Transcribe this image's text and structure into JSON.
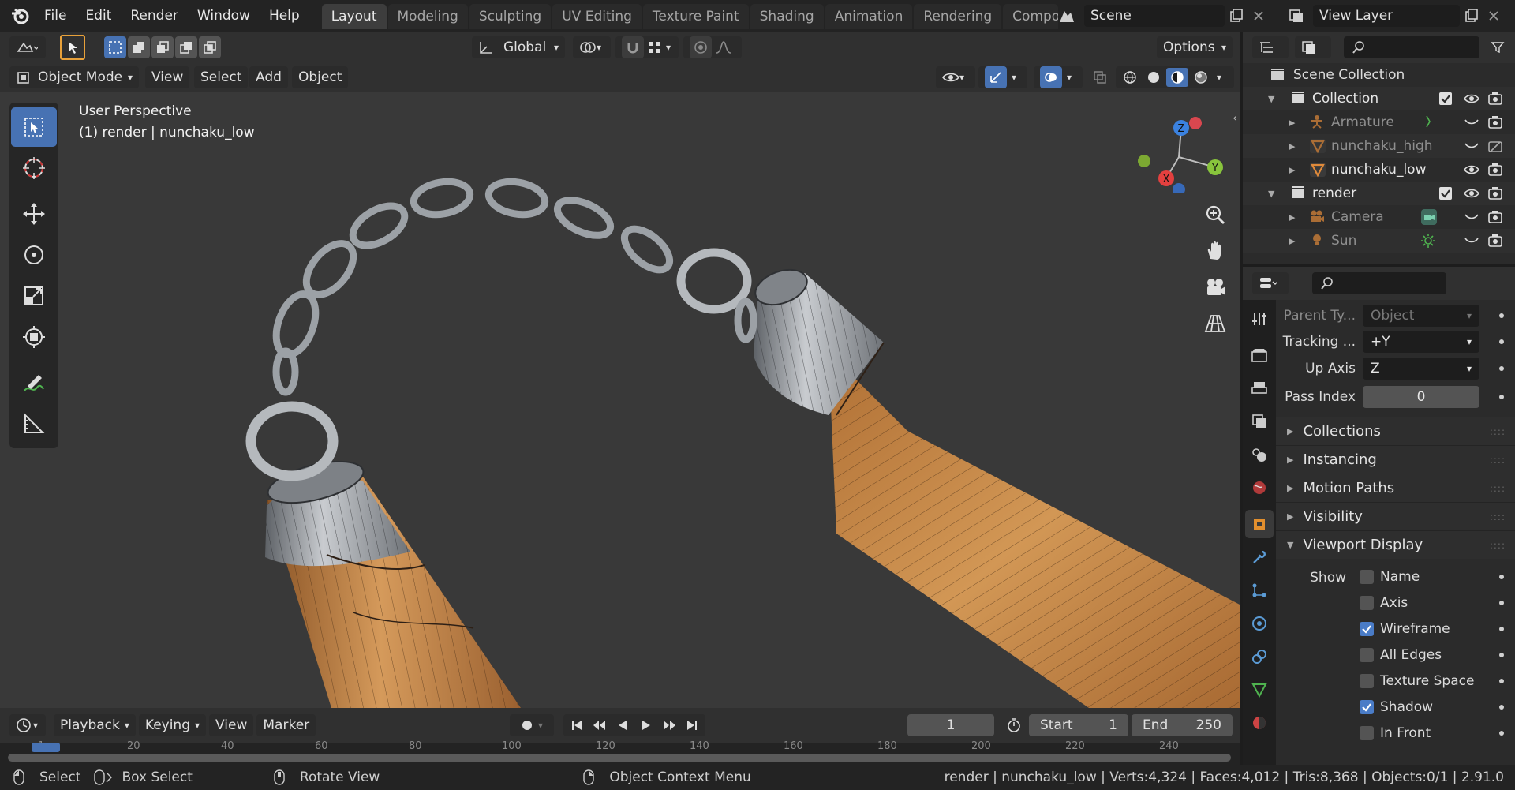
{
  "menu": [
    "File",
    "Edit",
    "Render",
    "Window",
    "Help"
  ],
  "workspaces": [
    "Layout",
    "Modeling",
    "Sculpting",
    "UV Editing",
    "Texture Paint",
    "Shading",
    "Animation",
    "Rendering",
    "Compos"
  ],
  "active_workspace": "Layout",
  "scene": {
    "label": "Scene"
  },
  "view_layer": {
    "label": "View Layer"
  },
  "viewport_header": {
    "transform_orientation": "Global",
    "options_label": "Options",
    "mode": "Object Mode",
    "menus": [
      "View",
      "Select",
      "Add",
      "Object"
    ]
  },
  "viewport": {
    "perspective_label": "User Perspective",
    "object_label": "(1) render | nunchaku_low",
    "gizmo_axes": [
      "Z",
      "Y",
      "X"
    ]
  },
  "outliner": {
    "root": "Scene Collection",
    "rows": [
      {
        "label": "Collection",
        "kind": "collection",
        "indent": 0,
        "dim": false
      },
      {
        "label": "Armature",
        "kind": "armature",
        "indent": 1,
        "dim": true
      },
      {
        "label": "nunchaku_high",
        "kind": "mesh",
        "indent": 1,
        "dim": true
      },
      {
        "label": "nunchaku_low",
        "kind": "mesh",
        "indent": 1,
        "dim": false
      },
      {
        "label": "render",
        "kind": "collection",
        "indent": 0,
        "dim": false
      },
      {
        "label": "Camera",
        "kind": "camera",
        "indent": 1,
        "dim": true
      },
      {
        "label": "Sun",
        "kind": "light",
        "indent": 1,
        "dim": true
      }
    ]
  },
  "properties": {
    "fields": [
      {
        "label": "Parent Ty...",
        "value": "Object",
        "dim": true
      },
      {
        "label": "Tracking ...",
        "value": "+Y",
        "dim": false
      },
      {
        "label": "Up Axis",
        "value": "Z",
        "dim": false
      },
      {
        "label": "Pass Index",
        "value": "0",
        "dim": false
      }
    ],
    "panels": [
      "Collections",
      "Instancing",
      "Motion Paths",
      "Visibility",
      "Viewport Display"
    ],
    "show_label": "Show",
    "checkboxes": [
      {
        "label": "Name",
        "checked": false
      },
      {
        "label": "Axis",
        "checked": false
      },
      {
        "label": "Wireframe",
        "checked": true
      },
      {
        "label": "All Edges",
        "checked": false
      },
      {
        "label": "Texture Space",
        "checked": false
      },
      {
        "label": "Shadow",
        "checked": true
      },
      {
        "label": "In Front",
        "checked": false
      }
    ]
  },
  "timeline": {
    "menus": [
      "Playback",
      "Keying",
      "View",
      "Marker"
    ],
    "current_frame": "1",
    "start_label": "Start",
    "start": "1",
    "end_label": "End",
    "end": "250",
    "ruler": [
      "1",
      "20",
      "40",
      "60",
      "80",
      "100",
      "120",
      "140",
      "160",
      "180",
      "200",
      "220",
      "240"
    ]
  },
  "status": {
    "select": "Select",
    "box_select": "Box Select",
    "rotate_view": "Rotate View",
    "context_menu": "Object Context Menu",
    "stats": "render | nunchaku_low | Verts:4,324 | Faces:4,012 | Tris:8,368 | Objects:0/1 | 2.91.0"
  },
  "colors": {
    "accent": "#4772b3",
    "wood": "#c98a4b",
    "metal": "#8a8f94",
    "checked": "#4a7cc7"
  }
}
